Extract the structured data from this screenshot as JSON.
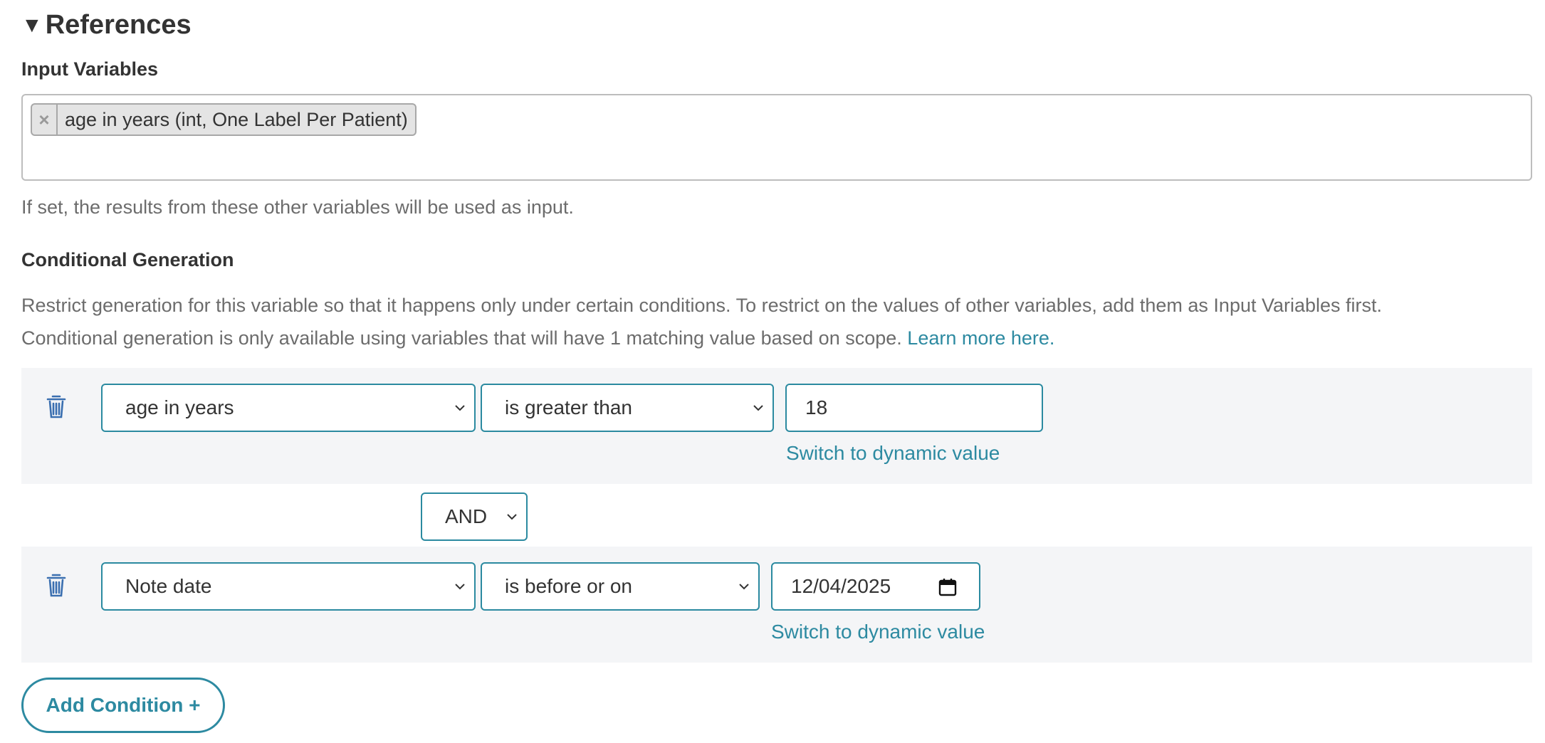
{
  "section": {
    "caret": "▼",
    "title": "References"
  },
  "input_variables": {
    "label": "Input Variables",
    "tags": [
      {
        "remove_symbol": "×",
        "text": "age in years (int, One Label Per Patient)"
      }
    ],
    "help": "If set, the results from these other variables will be used as input."
  },
  "conditional": {
    "label": "Conditional Generation",
    "description_line1": "Restrict generation for this variable so that it happens only under certain conditions. To restrict on the values of other variables, add them as Input Variables first.",
    "description_line2": "Conditional generation is only available using variables that will have 1 matching value based on scope.",
    "learn_more": "Learn more here.",
    "conditions": [
      {
        "variable": "age in years",
        "operator": "is greater than",
        "value": "18",
        "switch_link": "Switch to dynamic value"
      },
      {
        "variable": "Note date",
        "operator": "is before or on",
        "value": "12/04/2025",
        "switch_link": "Switch to dynamic value"
      }
    ],
    "joiner": "AND",
    "add_button": "Add Condition +"
  },
  "colors": {
    "accent": "#2d8aa1",
    "row_background": "#f4f5f7",
    "trash_icon": "#3a6fb0"
  }
}
